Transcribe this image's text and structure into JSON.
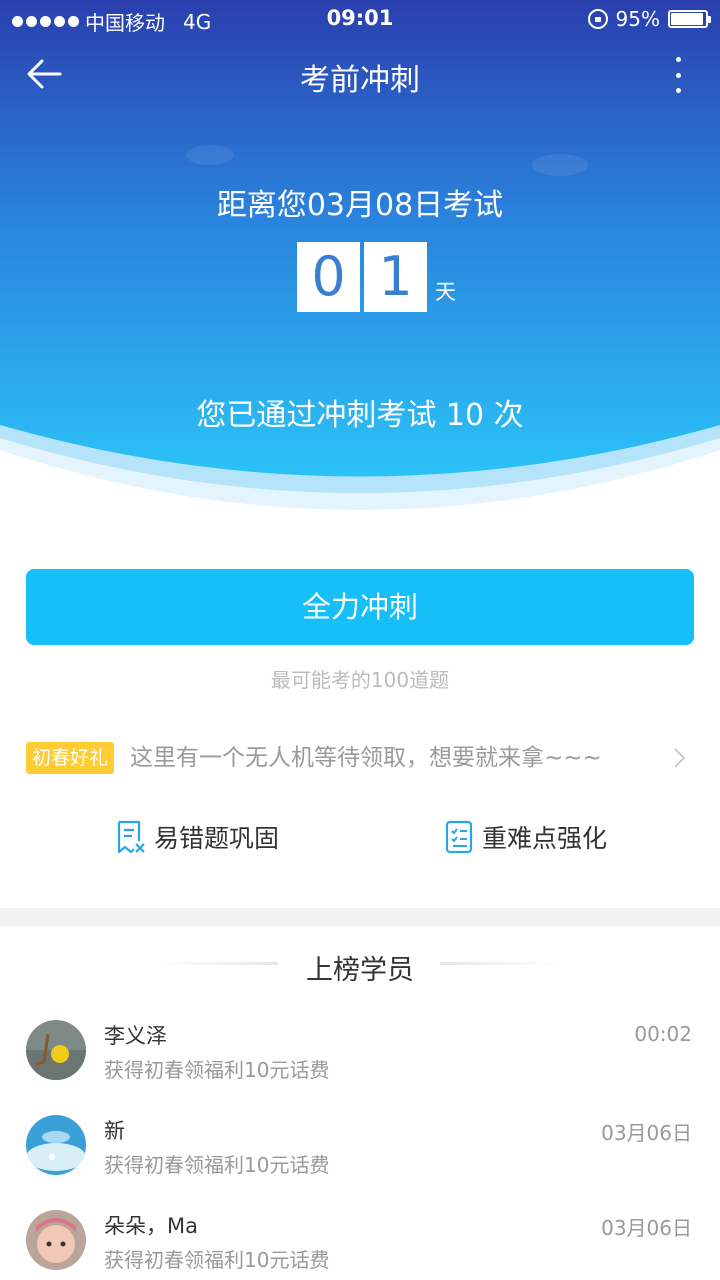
{
  "statusbar": {
    "carrier": "中国移动",
    "network": "4G",
    "time": "09:01",
    "battery": "95%",
    "battery_level": 0.95
  },
  "navbar": {
    "title": "考前冲刺"
  },
  "countdown": {
    "prefix": "距离您",
    "date": "03月08日",
    "suffix": "考试",
    "digit1": "0",
    "digit2": "1",
    "unit": "天"
  },
  "passed": {
    "text": "您已通过冲刺考试 10 次"
  },
  "main": {
    "sprint_label": "全力冲刺",
    "hint": "最可能考的100道题"
  },
  "promo": {
    "tag": "初春好礼",
    "text": "这里有一个无人机等待领取，想要就来拿~~~"
  },
  "shortcuts": [
    {
      "label": "易错题巩固",
      "icon": "wrong-questions-icon"
    },
    {
      "label": "重难点强化",
      "icon": "key-points-icon"
    }
  ],
  "ranking": {
    "title": "上榜学员",
    "items": [
      {
        "name": "李义泽",
        "desc": "获得初春领福利10元话费",
        "time": "00:02"
      },
      {
        "name": "新",
        "desc": "获得初春领福利10元话费",
        "time": "03月06日"
      },
      {
        "name": "朵朵，Ma",
        "desc": "获得初春领福利10元话费",
        "time": "03月06日"
      }
    ]
  },
  "colors": {
    "hero_top": "#2a3fae",
    "hero_bottom": "#2bc2f7",
    "accent": "#17bff8",
    "tag": "#ffcc33"
  }
}
